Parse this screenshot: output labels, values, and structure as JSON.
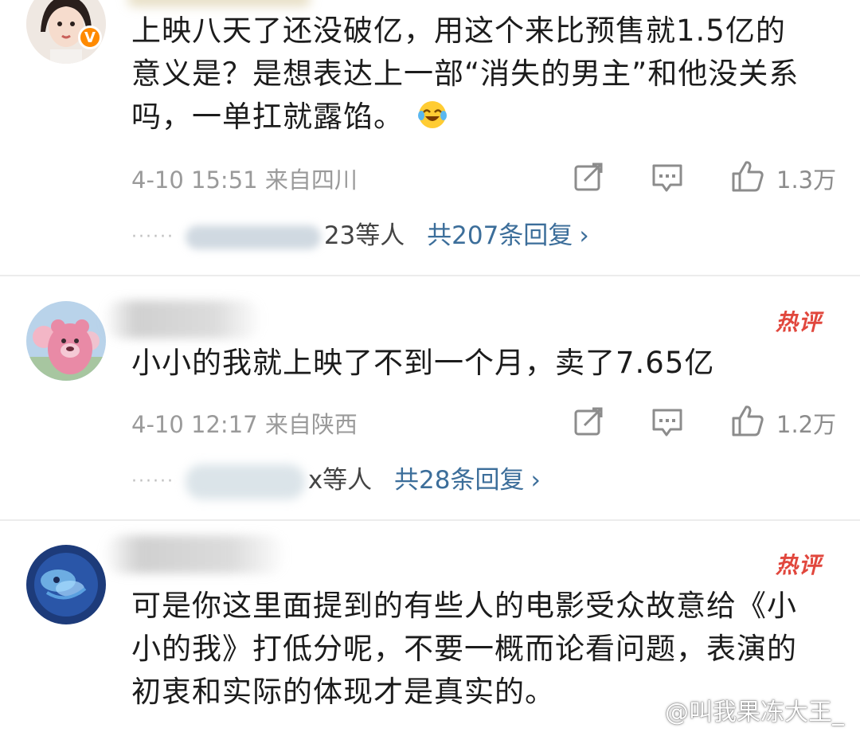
{
  "comments": [
    {
      "text_lines": [
        "上映八天了还没破亿，用这个来比预售就1.5亿的",
        "意义是？是想表达上一部“消失的男主”和他没关系",
        "吗，一单扛就露馅。"
      ],
      "emoji": "laugh-cry-emoji",
      "meta": "4-10 15:51 来自四川",
      "likes": "1.3万",
      "replies_names": "23等人",
      "replies_link": "共207条回复",
      "chevron": "›"
    },
    {
      "hot_label": "热评",
      "text_lines": [
        "小小的我就上映了不到一个月，卖了7.65亿"
      ],
      "meta": "4-10 12:17 来自陕西",
      "likes": "1.2万",
      "replies_names": "x等人",
      "replies_link": "共28条回复",
      "chevron": "›"
    },
    {
      "hot_label": "热评",
      "text_lines": [
        "可是你这里面提到的有些人的电影受众故意给《小",
        "小的我》打低分呢，不要一概而论看问题，表演的",
        "初衷和实际的体现才是真实的。"
      ]
    }
  ],
  "watermark": "@叫我果冻大王_",
  "colors": {
    "hot": "#e1473d",
    "link": "#3c6e9a",
    "meta": "#9a9a9a",
    "verified_badge": "#ff8a00"
  }
}
